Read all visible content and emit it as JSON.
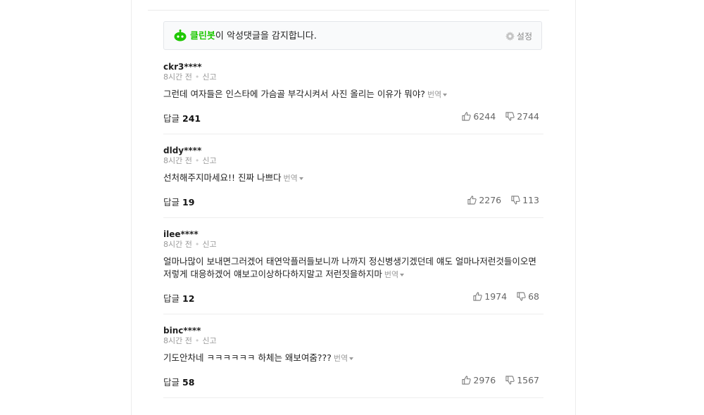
{
  "cleanbot": {
    "brand": "클린봇",
    "message": "이 악성댓글을 감지합니다.",
    "settings_label": "설정",
    "brand_color": "#1ec800"
  },
  "comments": [
    {
      "user": "ckr3****",
      "time": "8시간 전",
      "report": "신고",
      "text": "그런데 여자들은 인스타에 가슴골 부각시켜서 사진 올리는 이유가 뭐야?",
      "translate": "번역",
      "reply_label": "답글",
      "reply_count": "241",
      "likes": "6244",
      "dislikes": "2744"
    },
    {
      "user": "dldy****",
      "time": "8시간 전",
      "report": "신고",
      "text": "선처해주지마세요!! 진짜 나쁘다",
      "translate": "번역",
      "reply_label": "답글",
      "reply_count": "19",
      "likes": "2276",
      "dislikes": "113"
    },
    {
      "user": "ilee****",
      "time": "8시간 전",
      "report": "신고",
      "text": "얼마나많이 보내면그러겠어 태연악플러들보니까 나까지 정신병생기겠던데 얘도 얼마나저런것들이오면 저렇게 대응하겠어 얘보고이상하다하지말고 저런짓을하지마",
      "translate": "번역",
      "reply_label": "답글",
      "reply_count": "12",
      "likes": "1974",
      "dislikes": "68"
    },
    {
      "user": "binc****",
      "time": "8시간 전",
      "report": "신고",
      "text": "기도안차네 ㅋㅋㅋㅋㅋㅋ 하체는 왜보여줌???",
      "translate": "번역",
      "reply_label": "답글",
      "reply_count": "58",
      "likes": "2976",
      "dislikes": "1567"
    }
  ]
}
